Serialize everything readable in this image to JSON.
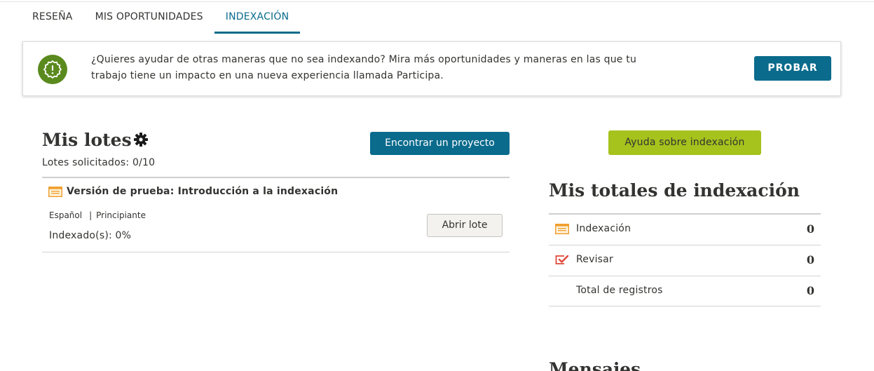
{
  "tabs": [
    {
      "label": "RESEÑA",
      "active": false
    },
    {
      "label": "MIS OPORTUNIDADES",
      "active": false
    },
    {
      "label": "INDEXACIÓN",
      "active": true
    }
  ],
  "banner": {
    "icon": "alert-badge-icon",
    "text": "¿Quieres ayudar de otras maneras que no sea indexando? Mira más oportunidades y maneras en las que tu trabajo tiene un impacto en una nueva experiencia llamada Participa.",
    "button_label": "PROBAR"
  },
  "lotes": {
    "title": "Mis lotes",
    "requested": "Lotes solicitados: 0/10",
    "find_button": "Encontrar un proyecto",
    "batch": {
      "title": "Versión de prueba: Introducción a la indexación",
      "language": "Español",
      "separator": "|",
      "level": "Principiante",
      "progress": "Indexado(s): 0%",
      "open_button": "Abrir lote"
    }
  },
  "totals": {
    "help_button": "Ayuda sobre indexación",
    "title": "Mis totales de indexación",
    "rows": [
      {
        "label": "Indexación",
        "value": "0",
        "icon": "indexing-icon"
      },
      {
        "label": "Revisar",
        "value": "0",
        "icon": "review-icon"
      },
      {
        "label": "Total de registros",
        "value": "0",
        "icon": ""
      }
    ]
  },
  "messages_title": "Mensajes",
  "colors": {
    "primary": "#0a6b8c",
    "help_green": "#a6c21c",
    "alert_green": "#5a8a1e",
    "indexing_orange": "#f0a030",
    "review_red": "#e0483a"
  }
}
